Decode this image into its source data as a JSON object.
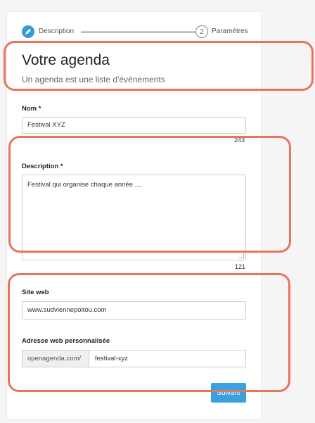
{
  "stepper": {
    "step1": {
      "label": "Description"
    },
    "step2": {
      "number": "2",
      "label": "Paramètres"
    }
  },
  "header": {
    "title": "Votre agenda",
    "subtitle": "Un agenda est une liste d'événements"
  },
  "form": {
    "name": {
      "label": "Nom *",
      "value": "Festival XYZ",
      "counter": "243"
    },
    "description": {
      "label": "Description *",
      "value": "Festival qui organise chaque année ....",
      "counter": "121"
    },
    "website": {
      "label": "Site web",
      "value": "www.sudviennepoitou.com"
    },
    "custom_url": {
      "label": "Adresse web personnalisée",
      "prefix": "openagenda.com/",
      "value": "festival-xyz"
    }
  },
  "actions": {
    "next_label": "Suivant"
  },
  "colors": {
    "accent": "#3a9ad9",
    "highlight": "#e8735f"
  }
}
